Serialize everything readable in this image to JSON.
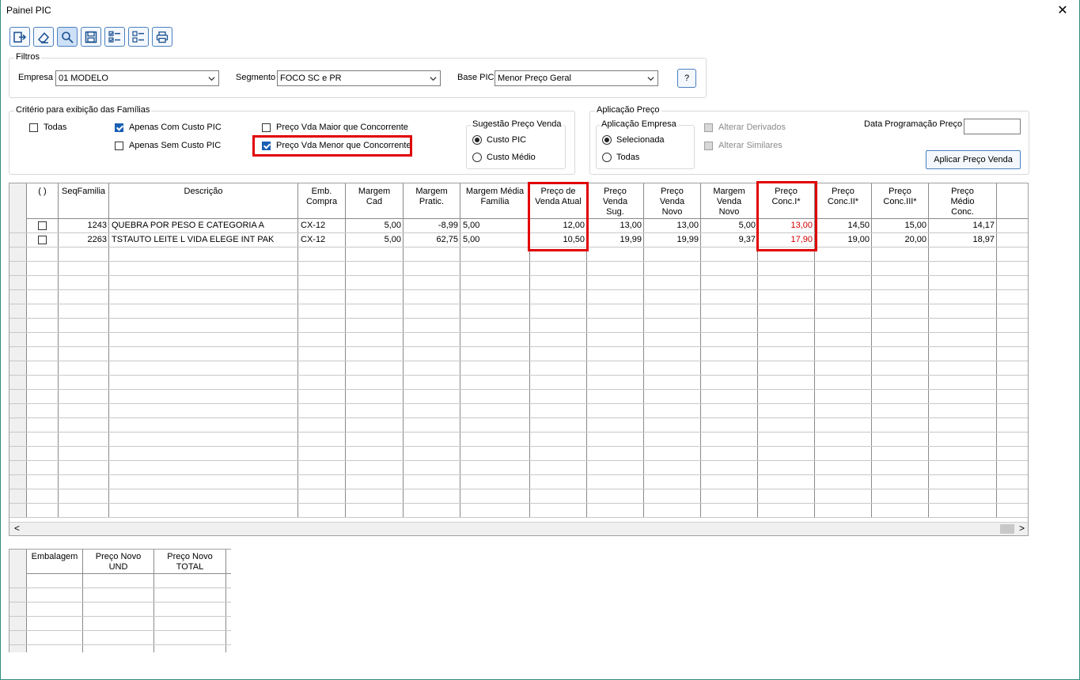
{
  "window": {
    "title": "Painel PIC",
    "close_glyph": "✕"
  },
  "toolbar": {
    "buttons": [
      {
        "name": "exit-icon"
      },
      {
        "name": "eraser-icon"
      },
      {
        "name": "search-icon"
      },
      {
        "name": "save-icon"
      },
      {
        "name": "checklist-checked-icon"
      },
      {
        "name": "checklist-empty-icon"
      },
      {
        "name": "print-icon"
      }
    ]
  },
  "filtros": {
    "label": "Filtros",
    "empresa_label": "Empresa",
    "empresa_value": "01 MODELO",
    "segmento_label": "Segmento",
    "segmento_value": "FOCO SC e PR",
    "base_label": "Base PIC",
    "base_value": "Menor Preço Geral",
    "help_label": "?"
  },
  "criterio": {
    "label": "Critério para exibição das Famílias",
    "todas": "Todas",
    "apenas_com_custo": "Apenas Com Custo PIC",
    "apenas_sem_custo": "Apenas Sem Custo PIC",
    "maior_concorrente": "Preço Vda Maior que Concorrente",
    "menor_concorrente": "Preço Vda Menor que Concorrente",
    "sugestao_label": "Sugestão Preço Venda",
    "custo_pic": "Custo PIC",
    "custo_medio": "Custo Médio"
  },
  "aplicacao": {
    "label": "Aplicação Preço",
    "empresa_label": "Aplicação Empresa",
    "selecionada": "Selecionada",
    "todas": "Todas",
    "alterar_derivados": "Alterar Derivados",
    "alterar_similares": "Alterar Similares",
    "data_label": "Data Programação Preço",
    "data_value": "",
    "aplicar_button": "Aplicar Preço Venda"
  },
  "grid": {
    "headers": [
      "( )",
      "SeqFamilia",
      "Descrição",
      "Emb.\nCompra",
      "Margem\nCad",
      "Margem\nPratic.",
      "Margem Média\nFamília",
      "Preço de\nVenda Atual",
      "Preço\nVenda\nSug.",
      "Preço\nVenda\nNovo",
      "Margem\nVenda\nNovo",
      "Preço\nConc.I*",
      "Preço\nConc.II*",
      "Preço\nConc.III*",
      "Preço\nMédio\nConc."
    ],
    "rows": [
      {
        "seq": "1243",
        "desc": "QUEBRA POR PESO E CATEGORIA A",
        "emb": "CX-12",
        "mcad": "5,00",
        "mprat": "-8,99",
        "mmed": "5,00",
        "atual": "12,00",
        "sug": "13,00",
        "novo": "13,00",
        "mnovo": "5,00",
        "c1": "13,00",
        "c2": "14,50",
        "c3": "15,00",
        "cmed": "14,17"
      },
      {
        "seq": "2263",
        "desc": "TSTAUTO  LEITE L VIDA ELEGE INT PAK",
        "emb": "CX-12",
        "mcad": "5,00",
        "mprat": "62,75",
        "mmed": "5,00",
        "atual": "10,50",
        "sug": "19,99",
        "novo": "19,99",
        "mnovo": "9,37",
        "c1": "17,90",
        "c2": "19,00",
        "c3": "20,00",
        "cmed": "18,97"
      }
    ],
    "scroll_left": "<",
    "scroll_right": ">"
  },
  "grid2": {
    "headers": [
      "Embalagem",
      "Preço Novo\nUND",
      "Preço Novo\nTOTAL"
    ]
  }
}
